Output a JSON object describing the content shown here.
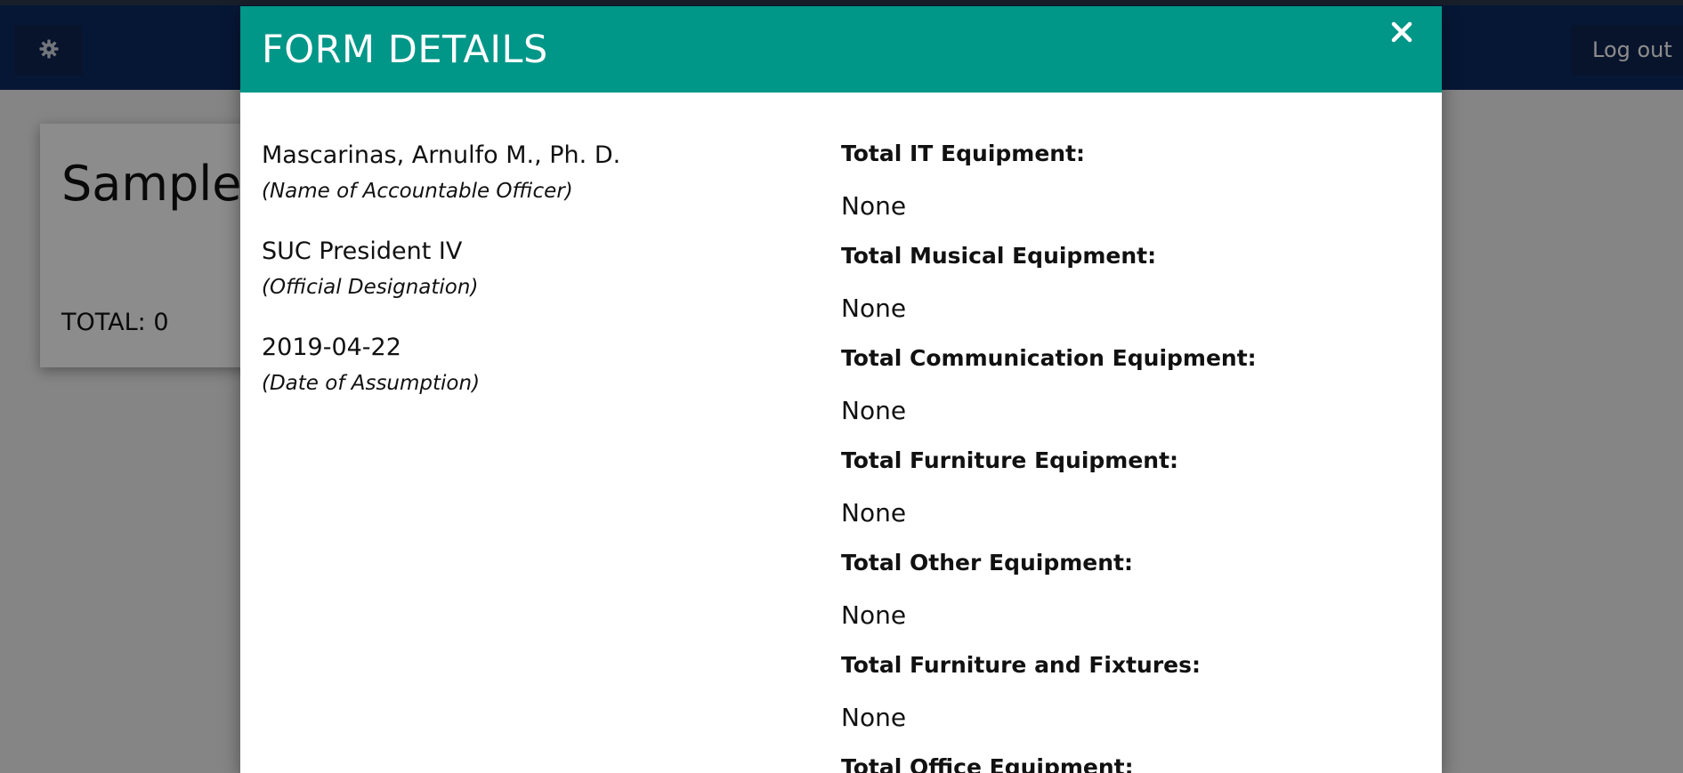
{
  "app": {
    "logout_label": "Log out",
    "background_card": {
      "title": "Sample D",
      "total_text": "TOTAL: 0"
    }
  },
  "modal": {
    "title": "FORM DETAILS",
    "close_icon": "close-icon",
    "left": {
      "officer_name": "Mascarinas, Arnulfo M., Ph. D.",
      "officer_name_label": "(Name of Accountable Officer)",
      "designation": "SUC President IV",
      "designation_label": "(Official Designation)",
      "date_of_assumption": "2019-04-22",
      "date_label": "(Date of Assumption)"
    },
    "totals": [
      {
        "label": "Total IT Equipment:",
        "value": "None"
      },
      {
        "label": "Total Musical Equipment:",
        "value": "None"
      },
      {
        "label": "Total Communication Equipment:",
        "value": "None"
      },
      {
        "label": "Total Furniture Equipment:",
        "value": "None"
      },
      {
        "label": "Total Other Equipment:",
        "value": "None"
      },
      {
        "label": "Total Furniture and Fixtures:",
        "value": "None"
      },
      {
        "label": "Total Office Equipment:",
        "value": ""
      }
    ]
  },
  "colors": {
    "navbar": "#0b2a63",
    "modal_header": "#009688",
    "backdrop": "rgba(0,0,0,0.45)"
  }
}
